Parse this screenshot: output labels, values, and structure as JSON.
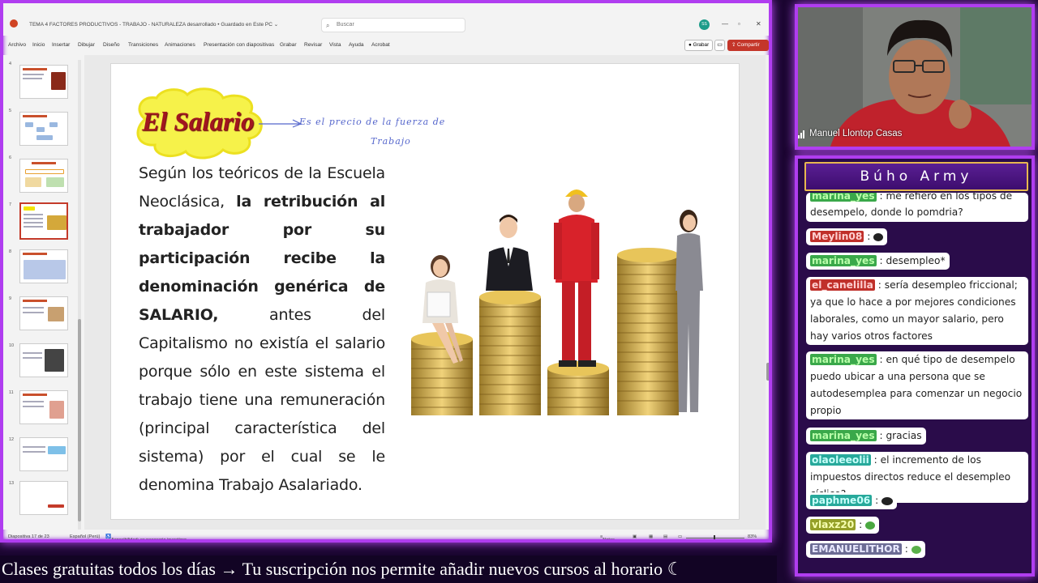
{
  "ppt": {
    "doc_title": "TEMA 4 FACTORES PRODUCTIVOS - TRABAJO - NATURALEZA desarrollado • Guardado en Este PC ⌄",
    "search_placeholder": "Buscar",
    "user_initials": "SS",
    "menu": [
      "Archivo",
      "Inicio",
      "Insertar",
      "Dibujar",
      "Diseño",
      "Transiciones",
      "Animaciones",
      "Presentación con diapositivas",
      "Grabar",
      "Revisar",
      "Vista",
      "Ayuda",
      "Acrobat"
    ],
    "grabar_label": "Grabar",
    "share_label": "Compartir",
    "thumb_numbers": [
      "4",
      "5",
      "6",
      "7",
      "8",
      "9",
      "10",
      "11",
      "12",
      "13"
    ],
    "selected_thumb": "7",
    "slide": {
      "title": "El Salario",
      "handwritten_line1": "Es el precio de la fuerza de",
      "handwritten_line2": "Trabajo",
      "body_part1": "Según los teóricos de la Escuela Neoclásica, ",
      "body_bold": "la retribución al trabajador por su participación recibe la denominación genérica de SALARIO,",
      "body_part2": " antes del Capitalismo no existía el salario porque sólo en este sistema el trabajo tiene una remuneración (principal característica del sistema) por el cual se le denomina Trabajo Asalariado."
    },
    "status": {
      "slide_count": "Diapositiva 17 de 23",
      "language": "Español (Perú)",
      "accessibility": "Accesibilidad: es necesario investigar",
      "notes": "Notas",
      "zoom": "83%"
    }
  },
  "ticker": "Clases gratuitas todos los días  →  Tu suscripción nos permite añadir nuevos cursos al horario  ☾",
  "webcam": {
    "name": "Manuel Llontop Casas"
  },
  "chat": {
    "title": "Búho Army",
    "messages": [
      {
        "user": "marina_yes",
        "text": "me refiero en los tipos de desempelo, donde lo pomdria?",
        "color": "green"
      },
      {
        "user": "Meylin08",
        "text": "",
        "color": "red"
      },
      {
        "user": "marina_yes",
        "text": "desempleo*",
        "color": "green"
      },
      {
        "user": "el_canelilla",
        "text": "sería desempleo friccional; ya que lo hace a por mejores condiciones laborales, como un mayor salario, pero hay varios otros factores",
        "color": "red"
      },
      {
        "user": "marina_yes",
        "text": "en qué tipo de desempelo puedo ubicar a una persona que se autodesempleа para comenzar un negocio propio",
        "color": "green"
      },
      {
        "user": "marina_yes",
        "text": "gracias",
        "color": "green"
      },
      {
        "user": "olaoleeolii",
        "text": "el incremento de los impuestos directos reduce el desempleo cíclico?",
        "color": "teal"
      },
      {
        "user": "paphme06",
        "text": "",
        "color": "teal"
      },
      {
        "user": "vlaxz20",
        "text": "",
        "color": "olive"
      },
      {
        "user": "EMANUELITHOR",
        "text": "",
        "color": "gray"
      }
    ]
  }
}
